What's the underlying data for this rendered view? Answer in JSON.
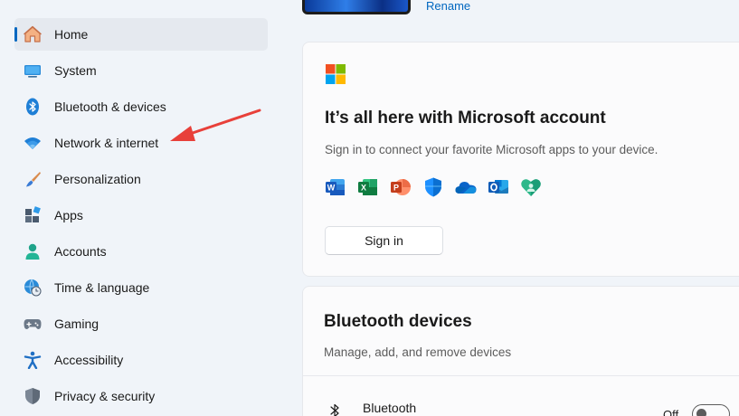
{
  "sidebar": {
    "items": [
      {
        "label": "Home",
        "icon": "home-icon",
        "active": true
      },
      {
        "label": "System",
        "icon": "system-icon"
      },
      {
        "label": "Bluetooth & devices",
        "icon": "bluetooth-icon"
      },
      {
        "label": "Network & internet",
        "icon": "wifi-icon"
      },
      {
        "label": "Personalization",
        "icon": "brush-icon"
      },
      {
        "label": "Apps",
        "icon": "apps-icon"
      },
      {
        "label": "Accounts",
        "icon": "person-icon"
      },
      {
        "label": "Time & language",
        "icon": "globe-clock-icon"
      },
      {
        "label": "Gaming",
        "icon": "gamepad-icon"
      },
      {
        "label": "Accessibility",
        "icon": "accessibility-icon"
      },
      {
        "label": "Privacy & security",
        "icon": "shield-icon"
      }
    ]
  },
  "header": {
    "rename_label": "Rename"
  },
  "microsoft_card": {
    "title": "It’s all here with Microsoft account",
    "subtitle": "Sign in to connect your favorite Microsoft apps to your device.",
    "apps": [
      "word-icon",
      "excel-icon",
      "powerpoint-icon",
      "defender-icon",
      "onedrive-icon",
      "outlook-icon",
      "family-safety-icon"
    ],
    "sign_in_label": "Sign in"
  },
  "bluetooth_card": {
    "title": "Bluetooth devices",
    "subtitle": "Manage, add, and remove devices",
    "row_label": "Bluetooth",
    "toggle_state": "Off"
  },
  "colors": {
    "accent": "#0067c0",
    "annotation_arrow": "#e8403a"
  }
}
